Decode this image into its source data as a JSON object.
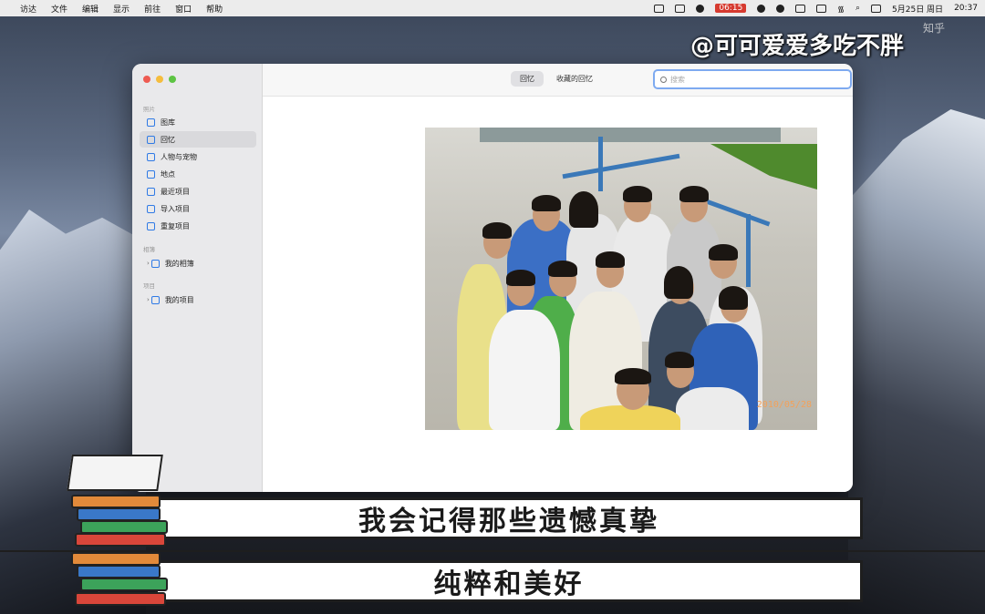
{
  "menubar": {
    "apple": "",
    "items": [
      "访达",
      "文件",
      "编辑",
      "显示",
      "前往",
      "窗口",
      "帮助"
    ],
    "timer": "06:15",
    "date": "5月25日 周日",
    "clock": "20:37"
  },
  "watermark": {
    "text": "@可可爱爱多吃不胖",
    "corner": "知乎"
  },
  "window": {
    "tabs": [
      "回忆",
      "收藏的回忆"
    ],
    "search_placeholder": "搜索",
    "sidebar": {
      "section_library": "照片",
      "items": [
        "图库",
        "回忆",
        "人物与宠物",
        "地点",
        "最近项目",
        "导入项目",
        "重复项目"
      ],
      "section_albums": "相簿",
      "album_item": "我的相簿",
      "section_projects": "项目",
      "project_item": "我的项目"
    }
  },
  "photo": {
    "date_stamp": "2010/05/28"
  },
  "subtitles": {
    "line1": "我会记得那些遗憾真挚",
    "line2": "纯粹和美好"
  }
}
